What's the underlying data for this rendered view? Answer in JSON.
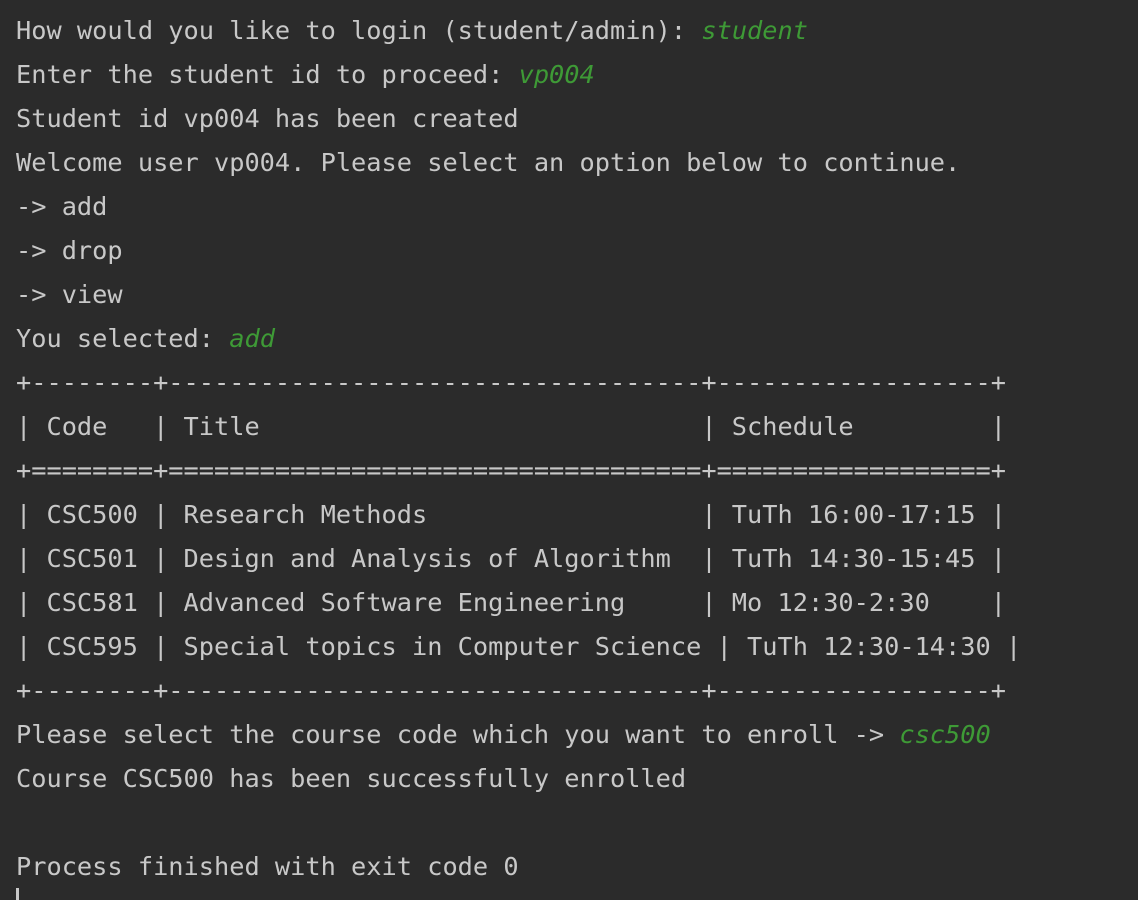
{
  "console": {
    "login_prompt": "How would you like to login (student/admin): ",
    "login_input": "student",
    "id_prompt": "Enter the student id to proceed: ",
    "id_input": "vp004",
    "created_msg": "Student id vp004 has been created",
    "welcome_msg": "Welcome user vp004. Please select an option below to continue.",
    "options": [
      "-> add",
      "-> drop",
      "-> view"
    ],
    "selected_prompt": "You selected: ",
    "selected_input": "add",
    "table": {
      "border_top": "+--------+-----------------------------------+------------------+",
      "header_row": "| Code   | Title                             | Schedule         |",
      "border_header": "+========+===================================+==================+",
      "rows": [
        "| CSC500 | Research Methods                  | TuTh 16:00-17:15 |",
        "| CSC501 | Design and Analysis of Algorithm  | TuTh 14:30-15:45 |",
        "| CSC581 | Advanced Software Engineering     | Mo 12:30-2:30    |",
        "| CSC595 | Special topics in Computer Science | TuTh 12:30-14:30 |"
      ],
      "border_bottom": "+--------+-----------------------------------+------------------+"
    },
    "enroll_prompt": "Please select the course code which you want to enroll -> ",
    "enroll_input": "csc500",
    "enroll_result": "Course CSC500 has been successfully enrolled",
    "exit_msg": "Process finished with exit code 0"
  },
  "colors": {
    "background": "#2b2b2b",
    "output_text": "#c8c8c8",
    "user_input": "#3e9a36"
  }
}
